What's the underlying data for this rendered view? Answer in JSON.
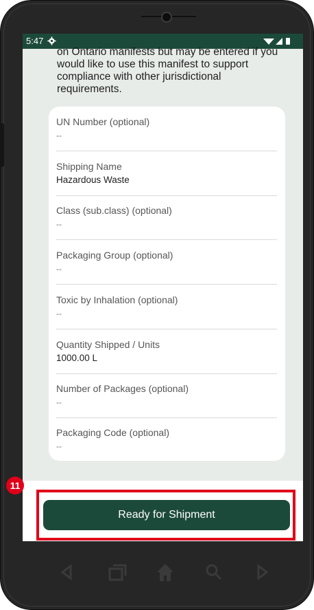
{
  "status_bar": {
    "time": "5:47",
    "icons": [
      "gear-icon",
      "wifi-icon",
      "signal-icon",
      "battery-icon"
    ]
  },
  "intro_text": "on Ontario manifests but may be entered if you would like to use this manifest to support compliance with other jurisdictional requirements.",
  "fields": [
    {
      "label": "UN Number (optional)",
      "value": "--"
    },
    {
      "label": "Shipping Name",
      "value": "Hazardous Waste"
    },
    {
      "label": "Class (sub.class) (optional)",
      "value": "--"
    },
    {
      "label": "Packaging Group (optional)",
      "value": "--"
    },
    {
      "label": "Toxic by Inhalation (optional)",
      "value": "--"
    },
    {
      "label": "Quantity Shipped / Units",
      "value": "1000.00 L"
    },
    {
      "label": "Number of Packages (optional)",
      "value": "--"
    },
    {
      "label": "Packaging Code (optional)",
      "value": "--"
    }
  ],
  "primary_action": {
    "label": "Ready for Shipment"
  },
  "annotation": {
    "step_number": "11",
    "color": "#e0001a"
  },
  "theme": {
    "accent": "#1c4a3a",
    "screen_bg": "#e8ece9",
    "card_bg": "#ffffff"
  },
  "nav_bar": {
    "icons": [
      "back-icon",
      "recent-apps-icon",
      "home-icon",
      "search-icon",
      "forward-icon"
    ]
  }
}
